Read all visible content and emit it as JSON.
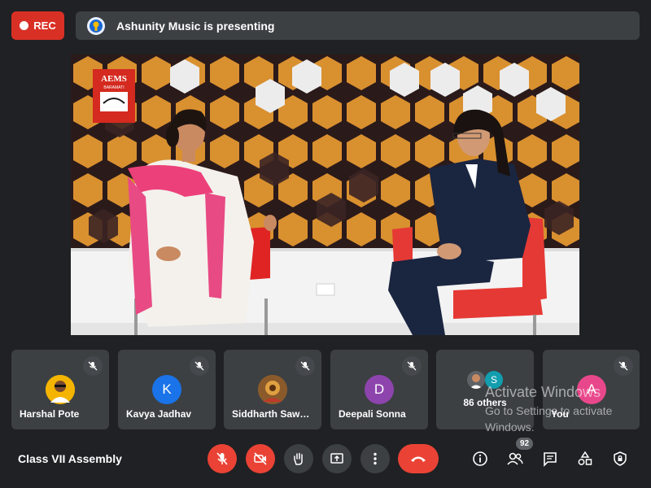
{
  "recording": {
    "label": "REC"
  },
  "presentation": {
    "text": "Ashunity Music is presenting"
  },
  "stage": {
    "logo_text": "AEMS",
    "logo_sub": "BARAMATI"
  },
  "participants": [
    {
      "name": "Harshal Pote",
      "initial": "",
      "color": "#f4b400"
    },
    {
      "name": "Kavya Jadhav",
      "initial": "K",
      "color": "#1a73e8"
    },
    {
      "name": "Siddharth Saw…",
      "initial": "",
      "color": "#a56b2c"
    },
    {
      "name": "Deepali Sonna",
      "initial": "D",
      "color": "#8e44ad"
    },
    {
      "name": "86 others",
      "initial": "S",
      "color": "#129eaf"
    },
    {
      "name": "You",
      "initial": "A",
      "color": "#e8488b"
    }
  ],
  "watermark": {
    "title": "Activate Windows",
    "subtitle": "Go to Settings to activate Windows."
  },
  "meeting": {
    "title": "Class VII Assembly"
  },
  "people_count": "92"
}
